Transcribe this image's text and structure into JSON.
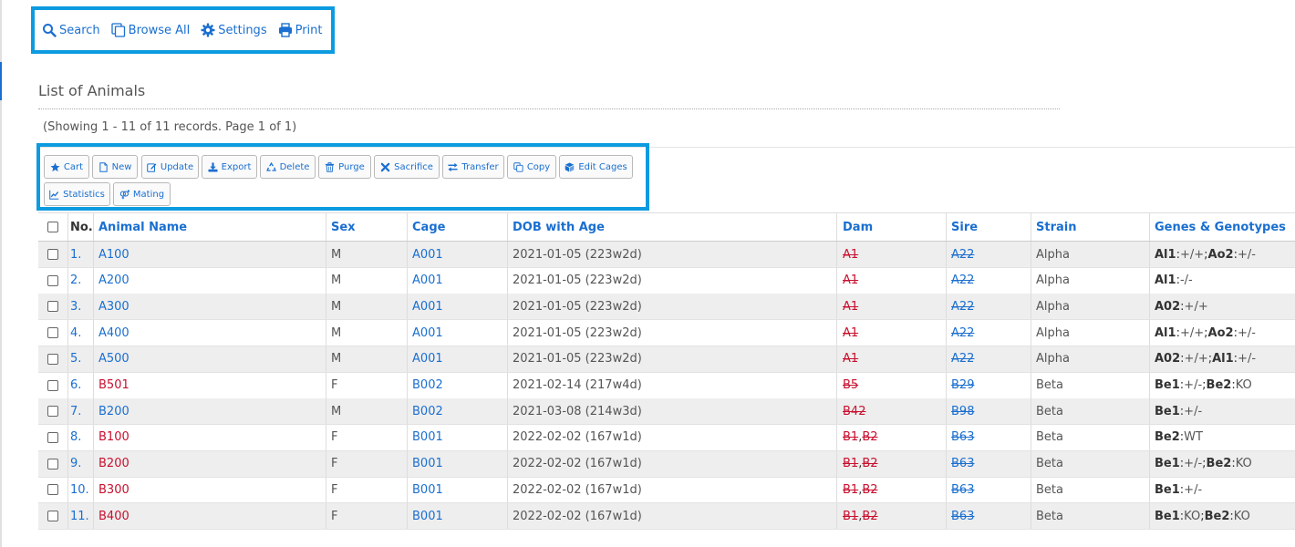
{
  "nav": {
    "search": "Search",
    "browse_all": "Browse All",
    "settings": "Settings",
    "print": "Print"
  },
  "page": {
    "title": "List of Animals",
    "records": "(Showing 1 - 11 of 11 records. Page 1 of 1)"
  },
  "toolbar": [
    {
      "label": "Cart",
      "icon": "star-icon"
    },
    {
      "label": "New",
      "icon": "file-icon"
    },
    {
      "label": "Update",
      "icon": "edit-icon"
    },
    {
      "label": "Export",
      "icon": "download-icon"
    },
    {
      "label": "Delete",
      "icon": "recycle-icon"
    },
    {
      "label": "Purge",
      "icon": "trash-icon"
    },
    {
      "label": "Sacrifice",
      "icon": "x-icon"
    },
    {
      "label": "Transfer",
      "icon": "exchange-icon"
    },
    {
      "label": "Copy",
      "icon": "copy-icon"
    },
    {
      "label": "Edit Cages",
      "icon": "cube-icon"
    },
    {
      "label": "Statistics",
      "icon": "chart-line-icon"
    },
    {
      "label": "Mating",
      "icon": "venus-mars-icon"
    }
  ],
  "table": {
    "columns": [
      "No.",
      "Animal Name",
      "Sex",
      "Cage",
      "DOB with Age",
      "Dam",
      "Sire",
      "Strain",
      "Genes & Genotypes"
    ],
    "rows": [
      {
        "no": "1.",
        "name": "A100",
        "name_color": "blue",
        "sex": "M",
        "cage": "A001",
        "dob": "2021-01-05 (223w2d)",
        "dam": [
          "A1"
        ],
        "sire": "A22",
        "strain": "Alpha",
        "genes": [
          {
            "g": "Al1",
            "v": "+/+"
          },
          {
            "g": "Ao2",
            "v": "+/-"
          }
        ]
      },
      {
        "no": "2.",
        "name": "A200",
        "name_color": "blue",
        "sex": "M",
        "cage": "A001",
        "dob": "2021-01-05 (223w2d)",
        "dam": [
          "A1"
        ],
        "sire": "A22",
        "strain": "Alpha",
        "genes": [
          {
            "g": "Al1",
            "v": "-/-"
          }
        ]
      },
      {
        "no": "3.",
        "name": "A300",
        "name_color": "blue",
        "sex": "M",
        "cage": "A001",
        "dob": "2021-01-05 (223w2d)",
        "dam": [
          "A1"
        ],
        "sire": "A22",
        "strain": "Alpha",
        "genes": [
          {
            "g": "A02",
            "v": "+/+"
          }
        ]
      },
      {
        "no": "4.",
        "name": "A400",
        "name_color": "blue",
        "sex": "M",
        "cage": "A001",
        "dob": "2021-01-05 (223w2d)",
        "dam": [
          "A1"
        ],
        "sire": "A22",
        "strain": "Alpha",
        "genes": [
          {
            "g": "Al1",
            "v": "+/+"
          },
          {
            "g": "Ao2",
            "v": "+/-"
          }
        ]
      },
      {
        "no": "5.",
        "name": "A500",
        "name_color": "blue",
        "sex": "M",
        "cage": "A001",
        "dob": "2021-01-05 (223w2d)",
        "dam": [
          "A1"
        ],
        "sire": "A22",
        "strain": "Alpha",
        "genes": [
          {
            "g": "A02",
            "v": "+/+"
          },
          {
            "g": "Al1",
            "v": "+/-"
          }
        ]
      },
      {
        "no": "6.",
        "name": "B501",
        "name_color": "red",
        "sex": "F",
        "cage": "B002",
        "dob": "2021-02-14 (217w4d)",
        "dam": [
          "B5"
        ],
        "sire": "B29",
        "strain": "Beta",
        "genes": [
          {
            "g": "Be1",
            "v": "+/-"
          },
          {
            "g": "Be2",
            "v": "KO"
          }
        ]
      },
      {
        "no": "7.",
        "name": "B200",
        "name_color": "blue",
        "sex": "M",
        "cage": "B002",
        "dob": "2021-03-08 (214w3d)",
        "dam": [
          "B42"
        ],
        "sire": "B98",
        "strain": "Beta",
        "genes": [
          {
            "g": "Be1",
            "v": "+/-"
          }
        ]
      },
      {
        "no": "8.",
        "name": "B100",
        "name_color": "red",
        "sex": "F",
        "cage": "B001",
        "dob": "2022-02-02 (167w1d)",
        "dam": [
          "B1",
          "B2"
        ],
        "sire": "B63",
        "strain": "Beta",
        "genes": [
          {
            "g": "Be2",
            "v": "WT"
          }
        ]
      },
      {
        "no": "9.",
        "name": "B200",
        "name_color": "red",
        "sex": "F",
        "cage": "B001",
        "dob": "2022-02-02 (167w1d)",
        "dam": [
          "B1",
          "B2"
        ],
        "sire": "B63",
        "strain": "Beta",
        "genes": [
          {
            "g": "Be1",
            "v": "+/-"
          },
          {
            "g": "Be2",
            "v": "KO"
          }
        ]
      },
      {
        "no": "10.",
        "name": "B300",
        "name_color": "red",
        "sex": "F",
        "cage": "B001",
        "dob": "2022-02-02 (167w1d)",
        "dam": [
          "B1",
          "B2"
        ],
        "sire": "B63",
        "strain": "Beta",
        "genes": [
          {
            "g": "Be1",
            "v": "+/-"
          }
        ]
      },
      {
        "no": "11.",
        "name": "B400",
        "name_color": "red",
        "sex": "F",
        "cage": "B001",
        "dob": "2022-02-02 (167w1d)",
        "dam": [
          "B1",
          "B2"
        ],
        "sire": "B63",
        "strain": "Beta",
        "genes": [
          {
            "g": "Be1",
            "v": "KO"
          },
          {
            "g": "Be2",
            "v": "KO"
          }
        ]
      }
    ]
  },
  "colors": {
    "link": "#1a6fd0",
    "female": "#c8102e",
    "highlight": "#0d9be0",
    "stripe": "#eeeeee"
  }
}
